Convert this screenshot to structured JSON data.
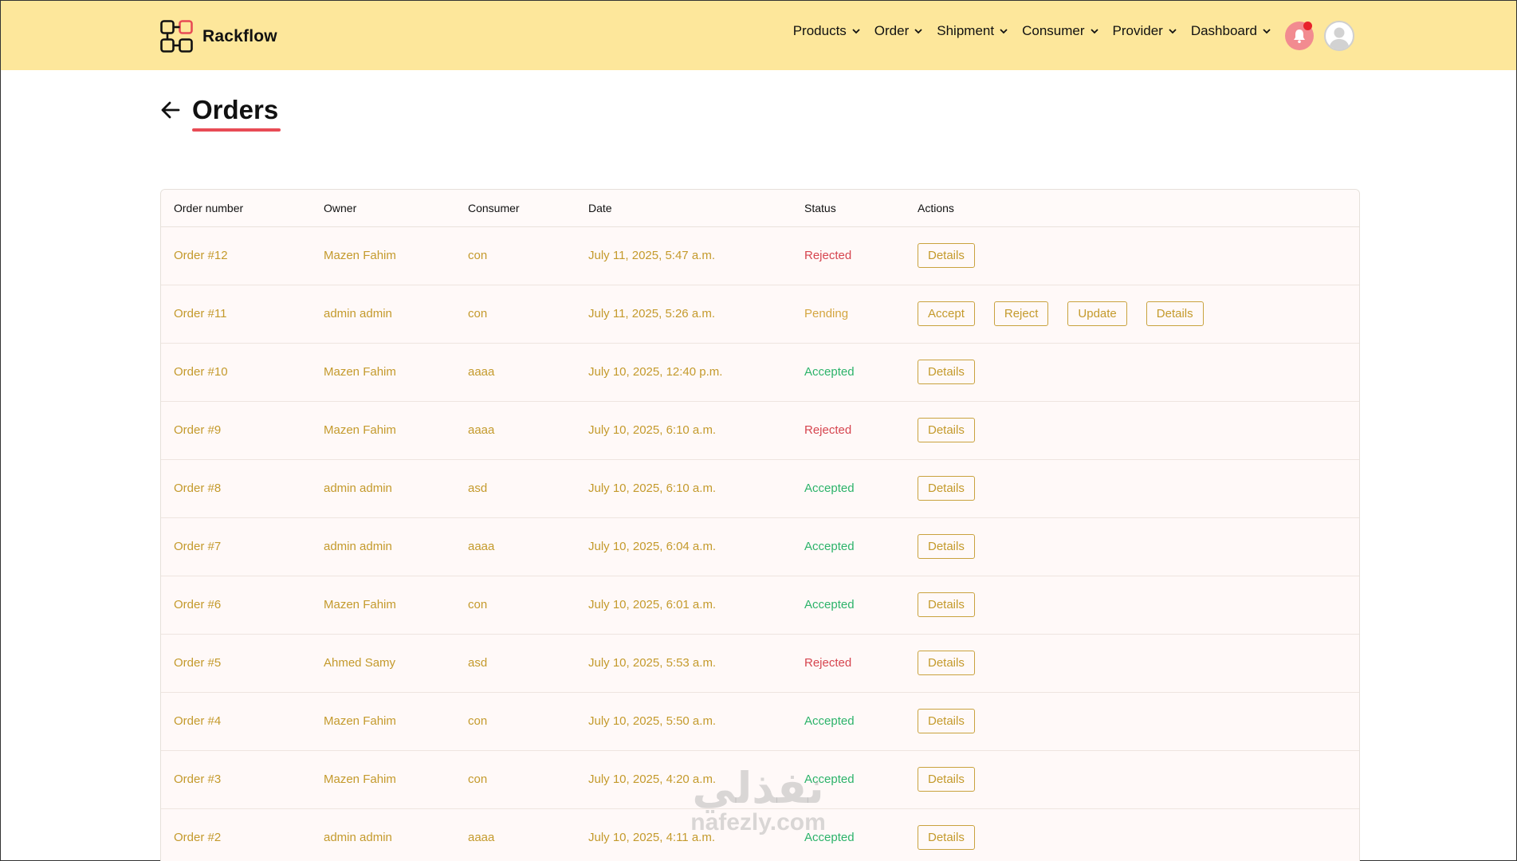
{
  "brand": {
    "name": "Rackflow"
  },
  "nav": {
    "items": [
      {
        "label": "Products"
      },
      {
        "label": "Order"
      },
      {
        "label": "Shipment"
      },
      {
        "label": "Consumer"
      },
      {
        "label": "Provider"
      },
      {
        "label": "Dashboard"
      }
    ]
  },
  "page": {
    "title": "Orders"
  },
  "table": {
    "headers": [
      "Order number",
      "Owner",
      "Consumer",
      "Date",
      "Status",
      "Actions"
    ],
    "rows": [
      {
        "order": "Order #12",
        "owner": "Mazen Fahim",
        "consumer": "con",
        "date": "July 11, 2025, 5:47 a.m.",
        "status": "Rejected",
        "actions": [
          "Details"
        ]
      },
      {
        "order": "Order #11",
        "owner": "admin admin",
        "consumer": "con",
        "date": "July 11, 2025, 5:26 a.m.",
        "status": "Pending",
        "actions": [
          "Accept",
          "Reject",
          "Update",
          "Details"
        ]
      },
      {
        "order": "Order #10",
        "owner": "Mazen Fahim",
        "consumer": "aaaa",
        "date": "July 10, 2025, 12:40 p.m.",
        "status": "Accepted",
        "actions": [
          "Details"
        ]
      },
      {
        "order": "Order #9",
        "owner": "Mazen Fahim",
        "consumer": "aaaa",
        "date": "July 10, 2025, 6:10 a.m.",
        "status": "Rejected",
        "actions": [
          "Details"
        ]
      },
      {
        "order": "Order #8",
        "owner": "admin admin",
        "consumer": "asd",
        "date": "July 10, 2025, 6:10 a.m.",
        "status": "Accepted",
        "actions": [
          "Details"
        ]
      },
      {
        "order": "Order #7",
        "owner": "admin admin",
        "consumer": "aaaa",
        "date": "July 10, 2025, 6:04 a.m.",
        "status": "Accepted",
        "actions": [
          "Details"
        ]
      },
      {
        "order": "Order #6",
        "owner": "Mazen Fahim",
        "consumer": "con",
        "date": "July 10, 2025, 6:01 a.m.",
        "status": "Accepted",
        "actions": [
          "Details"
        ]
      },
      {
        "order": "Order #5",
        "owner": "Ahmed Samy",
        "consumer": "asd",
        "date": "July 10, 2025, 5:53 a.m.",
        "status": "Rejected",
        "actions": [
          "Details"
        ]
      },
      {
        "order": "Order #4",
        "owner": "Mazen Fahim",
        "consumer": "con",
        "date": "July 10, 2025, 5:50 a.m.",
        "status": "Accepted",
        "actions": [
          "Details"
        ]
      },
      {
        "order": "Order #3",
        "owner": "Mazen Fahim",
        "consumer": "con",
        "date": "July 10, 2025, 4:20 a.m.",
        "status": "Accepted",
        "actions": [
          "Details"
        ]
      },
      {
        "order": "Order #2",
        "owner": "admin admin",
        "consumer": "aaaa",
        "date": "July 10, 2025, 4:11 a.m.",
        "status": "Accepted",
        "actions": [
          "Details"
        ]
      }
    ]
  },
  "watermark": {
    "arabic": "نفذلي",
    "latin": "nafezly.com"
  },
  "colors": {
    "header_bg": "#fde79b",
    "accent_red": "#e84b55",
    "link_gold": "#c49a2c",
    "status_rejected": "#d6454f",
    "status_pending": "#d4a640",
    "status_accepted": "#2cb36a"
  },
  "icons": {
    "logo": "rackflow-logo-icon",
    "nav_chevron": "chevron-down-icon",
    "back": "arrow-left-icon",
    "notifications": "bell-icon",
    "profile": "user-avatar-icon"
  }
}
